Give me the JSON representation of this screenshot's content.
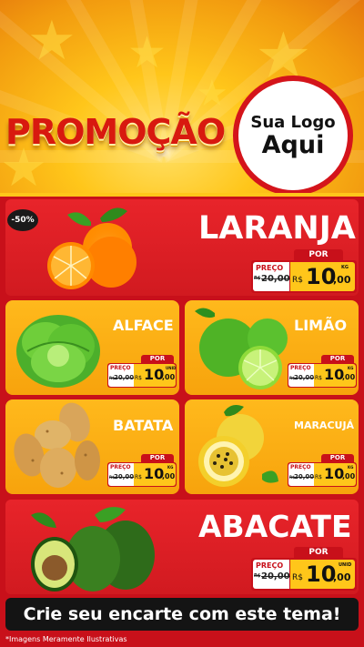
{
  "header": {
    "title": "PROMOÇÃO",
    "logo_line1": "Sua Logo",
    "logo_line2": "Aqui"
  },
  "featured_top": {
    "badge": "-50%",
    "name": "LARANJA",
    "por": "POR",
    "preco": "PREÇO",
    "old_prefix": "R$",
    "old_price": "20,00",
    "currency": "R$",
    "price_int": "10",
    "price_dec": ",00",
    "unit": "KG"
  },
  "cards": [
    {
      "name": "ALFACE",
      "por": "POR",
      "preco": "PREÇO",
      "old_prefix": "R$",
      "old_price": "20,00",
      "currency": "R$",
      "price_int": "10",
      "price_dec": ",00",
      "unit": "UNID"
    },
    {
      "name": "LIMÃO",
      "por": "POR",
      "preco": "PREÇO",
      "old_prefix": "R$",
      "old_price": "20,00",
      "currency": "R$",
      "price_int": "10",
      "price_dec": ",00",
      "unit": "KG"
    },
    {
      "name": "BATATA",
      "por": "POR",
      "preco": "PREÇO",
      "old_prefix": "R$",
      "old_price": "20,00",
      "currency": "R$",
      "price_int": "10",
      "price_dec": ",00",
      "unit": "KG"
    },
    {
      "name": "MARACUJÁ",
      "por": "POR",
      "preco": "PREÇO",
      "old_prefix": "R$",
      "old_price": "20,00",
      "currency": "R$",
      "price_int": "10",
      "price_dec": ",00",
      "unit": "KG"
    }
  ],
  "featured_bottom": {
    "name": "ABACATE",
    "por": "POR",
    "preco": "PREÇO",
    "old_prefix": "R$",
    "old_price": "20,00",
    "currency": "R$",
    "price_int": "10",
    "price_dec": ",00",
    "unit": "UNID"
  },
  "footer": {
    "cta": "Crie seu encarte com este tema!",
    "note": "*Imagens Meramente Ilustrativas"
  }
}
